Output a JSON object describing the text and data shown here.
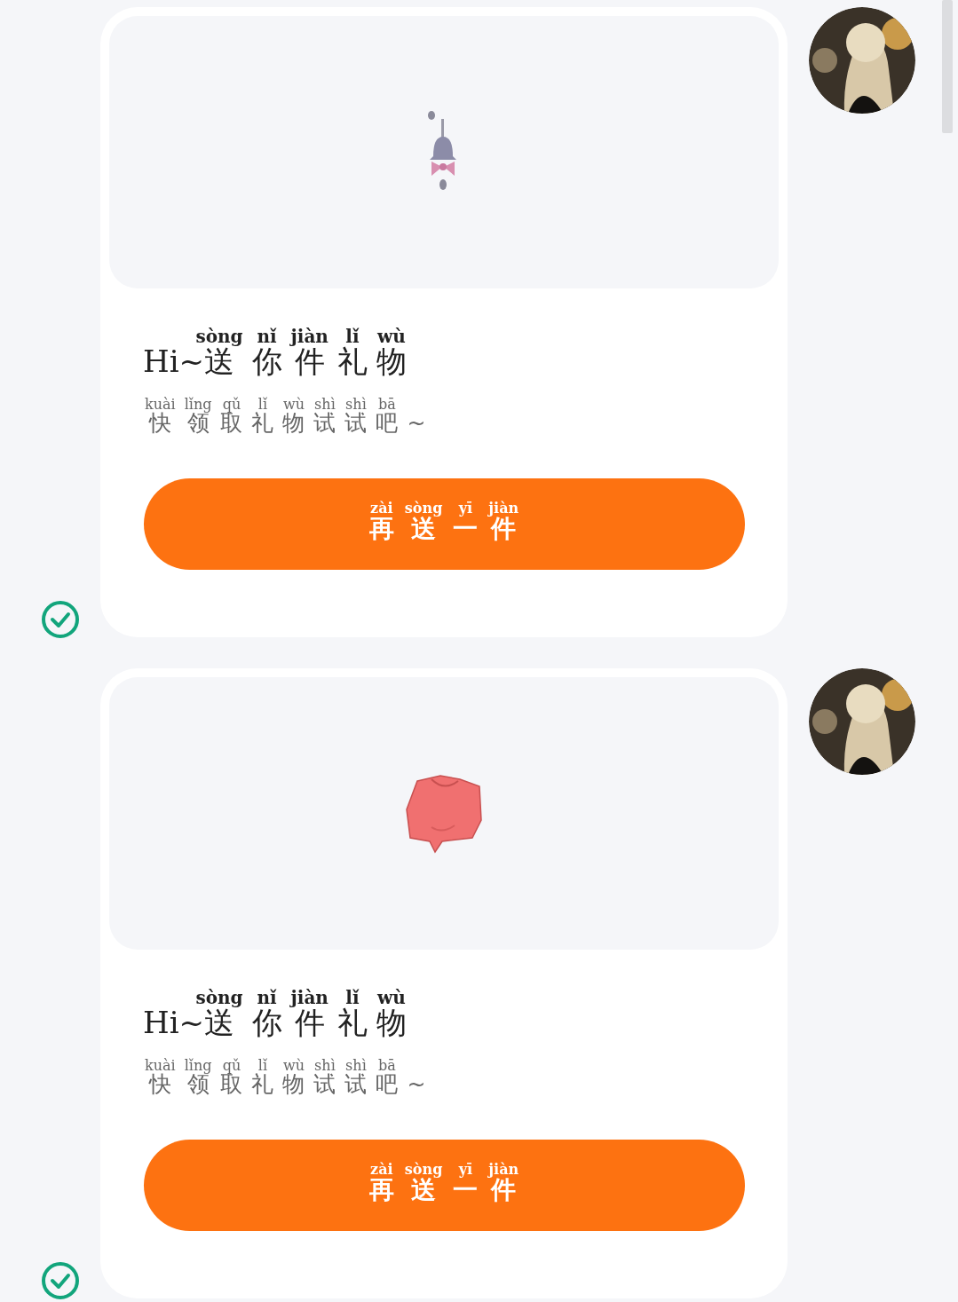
{
  "messages": [
    {
      "gift": {
        "kind": "bell"
      },
      "title": {
        "prefix": "Hi~",
        "chars": [
          {
            "hanzi": "送",
            "pinyin": "sòng"
          },
          {
            "hanzi": "你",
            "pinyin": "nǐ"
          },
          {
            "hanzi": "件",
            "pinyin": "jiàn"
          },
          {
            "hanzi": "礼",
            "pinyin": "lǐ"
          },
          {
            "hanzi": "物",
            "pinyin": "wù"
          }
        ]
      },
      "subtitle": {
        "chars": [
          {
            "hanzi": "快",
            "pinyin": "kuài"
          },
          {
            "hanzi": "领",
            "pinyin": "lǐng"
          },
          {
            "hanzi": "取",
            "pinyin": "qǔ"
          },
          {
            "hanzi": "礼",
            "pinyin": "lǐ"
          },
          {
            "hanzi": "物",
            "pinyin": "wù"
          },
          {
            "hanzi": "试",
            "pinyin": "shì"
          },
          {
            "hanzi": "试",
            "pinyin": "shì"
          },
          {
            "hanzi": "吧",
            "pinyin": "bā"
          }
        ],
        "suffix": "~"
      },
      "button": {
        "chars": [
          {
            "hanzi": "再",
            "pinyin": "zài"
          },
          {
            "hanzi": "送",
            "pinyin": "sòng"
          },
          {
            "hanzi": "一",
            "pinyin": "yī"
          },
          {
            "hanzi": "件",
            "pinyin": "jiàn"
          }
        ]
      },
      "read": true
    },
    {
      "gift": {
        "kind": "shirt"
      },
      "title": {
        "prefix": "Hi~",
        "chars": [
          {
            "hanzi": "送",
            "pinyin": "sòng"
          },
          {
            "hanzi": "你",
            "pinyin": "nǐ"
          },
          {
            "hanzi": "件",
            "pinyin": "jiàn"
          },
          {
            "hanzi": "礼",
            "pinyin": "lǐ"
          },
          {
            "hanzi": "物",
            "pinyin": "wù"
          }
        ]
      },
      "subtitle": {
        "chars": [
          {
            "hanzi": "快",
            "pinyin": "kuài"
          },
          {
            "hanzi": "领",
            "pinyin": "lǐng"
          },
          {
            "hanzi": "取",
            "pinyin": "qǔ"
          },
          {
            "hanzi": "礼",
            "pinyin": "lǐ"
          },
          {
            "hanzi": "物",
            "pinyin": "wù"
          },
          {
            "hanzi": "试",
            "pinyin": "shì"
          },
          {
            "hanzi": "试",
            "pinyin": "shì"
          },
          {
            "hanzi": "吧",
            "pinyin": "bā"
          }
        ],
        "suffix": "~"
      },
      "button": {
        "chars": [
          {
            "hanzi": "再",
            "pinyin": "zài"
          },
          {
            "hanzi": "送",
            "pinyin": "sòng"
          },
          {
            "hanzi": "一",
            "pinyin": "yī"
          },
          {
            "hanzi": "件",
            "pinyin": "jiàn"
          }
        ]
      },
      "read": true
    }
  ]
}
